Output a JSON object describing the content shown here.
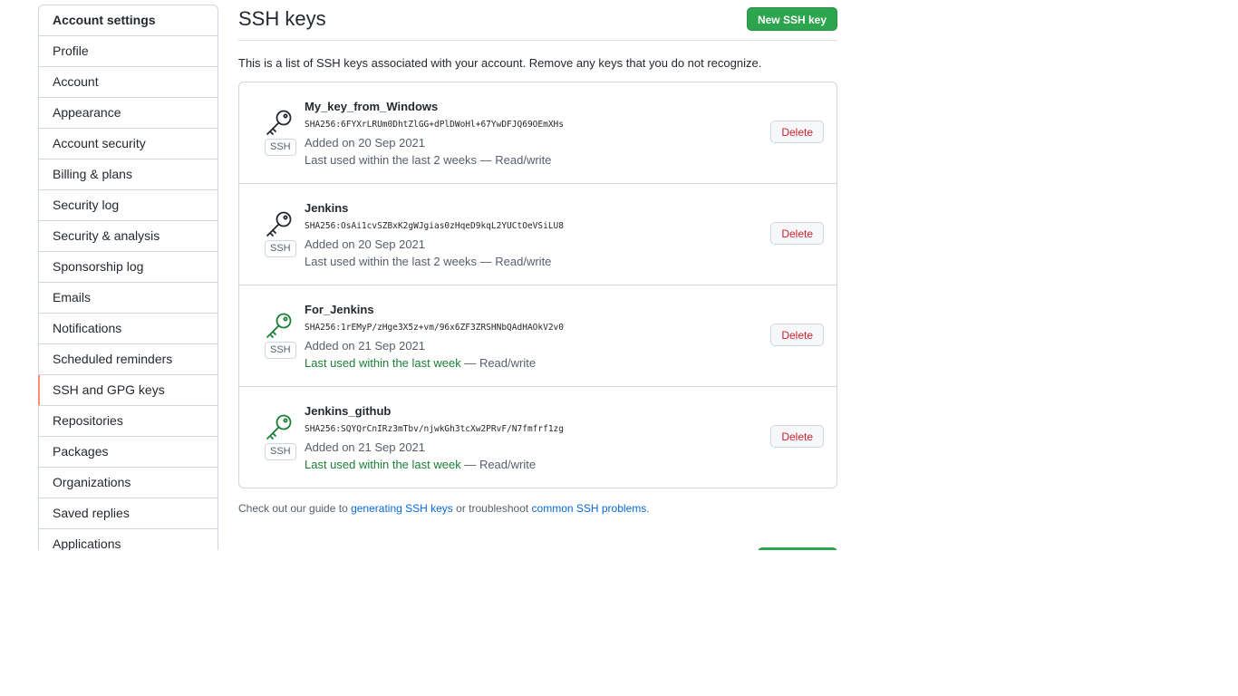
{
  "sidebar": {
    "header": "Account settings",
    "items": [
      {
        "label": "Profile"
      },
      {
        "label": "Account"
      },
      {
        "label": "Appearance"
      },
      {
        "label": "Account security"
      },
      {
        "label": "Billing & plans"
      },
      {
        "label": "Security log"
      },
      {
        "label": "Security & analysis"
      },
      {
        "label": "Sponsorship log"
      },
      {
        "label": "Emails"
      },
      {
        "label": "Notifications"
      },
      {
        "label": "Scheduled reminders"
      },
      {
        "label": "SSH and GPG keys"
      },
      {
        "label": "Repositories"
      },
      {
        "label": "Packages"
      },
      {
        "label": "Organizations"
      },
      {
        "label": "Saved replies"
      },
      {
        "label": "Applications"
      }
    ],
    "active_item": "SSH and GPG keys"
  },
  "main": {
    "title": "SSH keys",
    "new_button": "New SSH key",
    "description": "This is a list of SSH keys associated with your account. Remove any keys that you do not recognize.",
    "keys": [
      {
        "title": "My_key_from_Windows",
        "badge": "SSH",
        "fingerprint": "SHA256:6FYXrLRUm0DhtZlGG+dPlDWoHl+67YwDFJQ69OEmXHs",
        "added": "Added on 20 Sep 2021",
        "last_used_recent": "",
        "last_used": "Last used within the last 2 weeks — Read/write",
        "icon_color": "#24292f",
        "delete_label": "Delete"
      },
      {
        "title": "Jenkins",
        "badge": "SSH",
        "fingerprint": "SHA256:OsAi1cvSZBxK2gWJgias0zHqeD9kqL2YUCtOeVSiLU8",
        "added": "Added on 20 Sep 2021",
        "last_used_recent": "",
        "last_used": "Last used within the last 2 weeks — Read/write",
        "icon_color": "#24292f",
        "delete_label": "Delete"
      },
      {
        "title": "For_Jenkins",
        "badge": "SSH",
        "fingerprint": "SHA256:1rEMyP/zHge3X5z+vm/96x6ZF3ZRSHNbQAdHAOkV2v0",
        "added": "Added on 21 Sep 2021",
        "last_used_recent": "Last used within the last week",
        "last_used": " — Read/write",
        "icon_color": "#1a7f37",
        "delete_label": "Delete"
      },
      {
        "title": "Jenkins_github",
        "badge": "SSH",
        "fingerprint": "SHA256:SQYQrCnIRz3mTbv/njwkGh3tcXw2PRvF/N7fmfrf1zg",
        "added": "Added on 21 Sep 2021",
        "last_used_recent": "Last used within the last week",
        "last_used": " — Read/write",
        "icon_color": "#1a7f37",
        "delete_label": "Delete"
      }
    ],
    "footer": {
      "prefix": "Check out our guide to ",
      "link1": "generating SSH keys",
      "middle": " or troubleshoot ",
      "link2": "common SSH problems",
      "suffix": "."
    }
  },
  "colors": {
    "primary_green": "#2da44e",
    "danger_red": "#cf222e",
    "link_blue": "#0969da",
    "active_marker": "#fd8c73"
  }
}
